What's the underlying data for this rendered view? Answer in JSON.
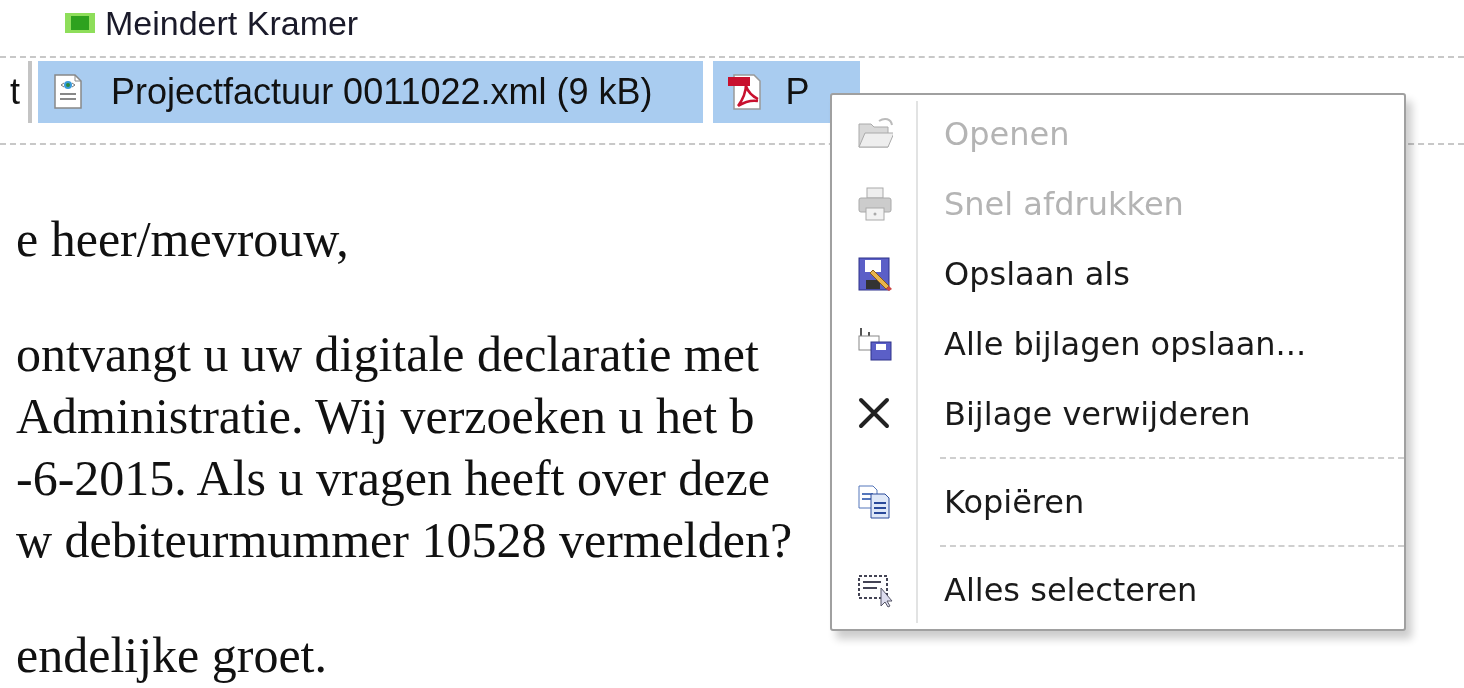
{
  "sender": {
    "name": "Meindert Kramer",
    "online": true
  },
  "attachments": [
    {
      "kind": "cut",
      "name": "t",
      "selected": false
    },
    {
      "kind": "xml",
      "name": "Projectfactuur 0011022.xml (9 kB)",
      "selected": true
    },
    {
      "kind": "pdf",
      "name": "P",
      "selected": true
    }
  ],
  "body": {
    "paragraphs": [
      {
        "lines": [
          "e heer/mevrouw,"
        ]
      },
      {
        "lines": [
          "ontvangt u uw digitale declaratie met",
          "Administratie. Wij verzoeken u het b",
          "-6-2015. Als u vragen heeft over deze",
          "w debiteurmummer 10528 vermelden?"
        ]
      },
      {
        "lines": [
          "endelijke groet."
        ]
      }
    ]
  },
  "context_menu": {
    "items": [
      {
        "kind": "open",
        "label": "Openen",
        "disabled": true
      },
      {
        "kind": "print",
        "label": "Snel afdrukken",
        "disabled": true
      },
      {
        "kind": "save-as",
        "label": "Opslaan als",
        "disabled": false
      },
      {
        "kind": "save-all",
        "label": "Alle bijlagen opslaan...",
        "disabled": false
      },
      {
        "kind": "remove",
        "label": "Bijlage verwijderen",
        "disabled": false
      },
      {
        "kind": "separator"
      },
      {
        "kind": "copy",
        "label": "Kopiëren",
        "disabled": false
      },
      {
        "kind": "separator"
      },
      {
        "kind": "select-all",
        "label": "Alles selecteren",
        "disabled": false
      }
    ]
  }
}
